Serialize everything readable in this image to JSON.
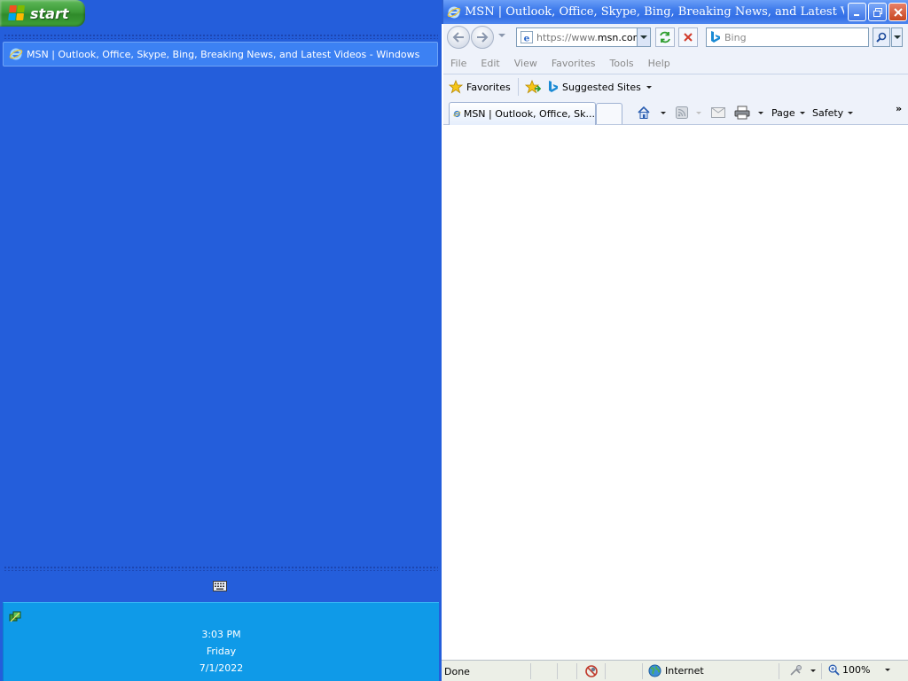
{
  "taskbar": {
    "start_label": "start",
    "task_title": "MSN | Outlook, Office, Skype, Bing, Breaking News, and Latest Videos - Windows",
    "clock": {
      "time": "3:03 PM",
      "day": "Friday",
      "date": "7/1/2022"
    }
  },
  "ie": {
    "window_title": "MSN | Outlook, Office, Skype, Bing, Breaking News, and Latest Vid...",
    "address": {
      "prefix": "https://www.",
      "domain": "msn.com"
    },
    "search_placeholder": "Bing",
    "menu": [
      "File",
      "Edit",
      "View",
      "Favorites",
      "Tools",
      "Help"
    ],
    "favorites_label": "Favorites",
    "suggested_sites_label": "Suggested Sites",
    "tab_title": "MSN | Outlook, Office, Sk...",
    "commands": {
      "page": "Page",
      "safety": "Safety",
      "more": "»"
    },
    "status": {
      "text": "Done",
      "zone": "Internet",
      "zoom": "100%"
    }
  },
  "colors": {
    "taskbar_blue": "#245edb",
    "start_green": "#3c9a37",
    "tray_blue": "#0f9ae8",
    "title_blue": "#3470e6"
  },
  "icons": [
    "windows-flag-icon",
    "ie-icon",
    "keyboard-icon",
    "network-icon",
    "back-icon",
    "forward-icon",
    "refresh-icon",
    "stop-icon",
    "bing-icon",
    "search-icon",
    "star-icon",
    "add-favorite-icon",
    "home-icon",
    "feeds-icon",
    "mail-icon",
    "print-icon",
    "globe-icon",
    "zoom-icon"
  ]
}
